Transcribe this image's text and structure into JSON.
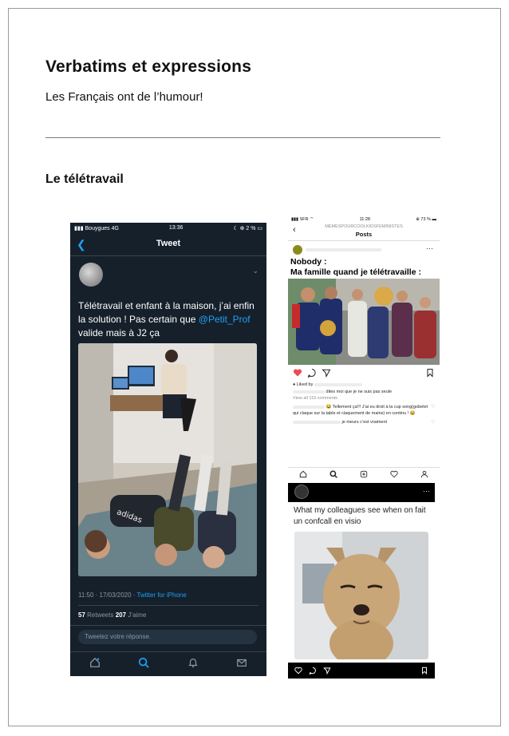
{
  "page": {
    "title": "Verbatims et expressions",
    "subtitle": "Les Français ont de l’humour!",
    "section_title": "Le télétravail"
  },
  "twitter": {
    "status_carrier": "Bouygues  4G",
    "status_time": "13:36",
    "status_battery": "2 %",
    "header_title": "Tweet",
    "tweet_text": "Télétravail et enfant à la maison, j’ai enfin la solution ! Pas certain que ",
    "tweet_mention": "@Petit_Prof",
    "tweet_text_end": " valide mais à J2 ça",
    "photo_shirt_text": "adidas",
    "timestamp": "11:50 · 17/03/2020 · ",
    "source": "Twitter for iPhone",
    "retweets_count": "57",
    "retweets_label": " Retweets  ",
    "likes_count": "207",
    "likes_label": " J’aime",
    "reply_placeholder": "Tweetez votre réponse.",
    "nav_icons": [
      "home-icon",
      "search-icon",
      "bell-icon",
      "mail-icon"
    ],
    "colors": {
      "background": "#15202b",
      "accent": "#1da1f2"
    }
  },
  "instagram": {
    "status_carrier": "SFR",
    "status_time": "11:28",
    "status_battery": "73 %",
    "account_name": "MEMESPOURCOOLKIDSFEMINISTES",
    "header_title": "Posts",
    "caption_line1": "Nobody :",
    "caption_line2": "Ma famille quand je télétravaille :",
    "liked_by": "Liked by",
    "comment1": "dites moi que je ne suis pas seule",
    "view_all": "View all 119 comments",
    "comment2": "😂 Tellement ça!!! J’ai eu droit à la cup song(gobelet qui claque sur la table et claquement de mains) en continu ! 😂",
    "comment3": "je meurs c’est vraiment",
    "colors": {
      "like": "#ed4956"
    }
  },
  "meme": {
    "caption": "What my colleagues see when on fait un confcall en visio"
  }
}
